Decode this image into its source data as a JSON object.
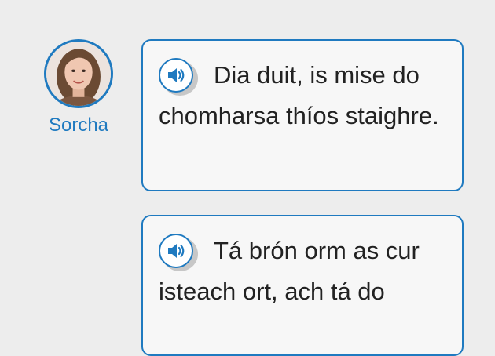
{
  "speaker": {
    "name": "Sorcha",
    "avatar": "woman-portrait"
  },
  "messages": [
    {
      "text": "Dia duit, is mise do chomharsa thíos staighre.",
      "audio_icon": "speaker-icon"
    },
    {
      "text": "Tá brón orm as cur isteach ort, ach tá do",
      "audio_icon": "speaker-icon"
    }
  ],
  "colors": {
    "accent": "#1f7ac0",
    "bubble_bg": "#f7f7f7",
    "page_bg": "#ededed"
  }
}
